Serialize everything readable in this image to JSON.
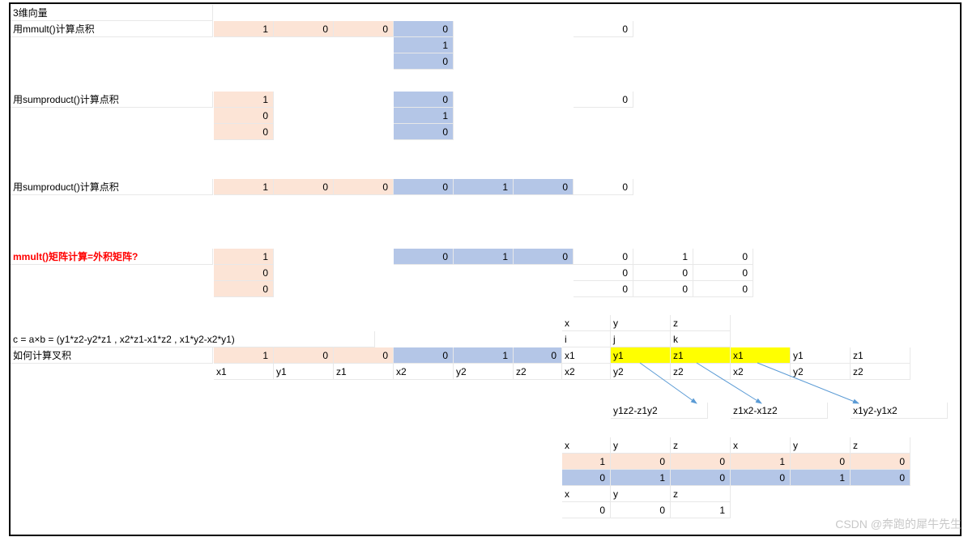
{
  "watermark": "CSDN @奔跑的犀牛先生",
  "labels": {
    "title": "3维向量",
    "mmult": "用mmult()计算点积",
    "sumprod1": "用sumproduct()计算点积",
    "sumprod2": "用sumproduct()计算点积",
    "outer": "mmult()矩阵计算=外积矩阵?",
    "formula": "c = a×b = (y1*z2-y2*z1 , x2*z1-x1*z2 , x1*y2-x2*y1)",
    "cross": "如何计算叉积",
    "x": "x",
    "y": "y",
    "z": "z",
    "i": "i",
    "j": "j",
    "k": "k",
    "x1": "x1",
    "y1": "y1",
    "z1": "z1",
    "x2": "x2",
    "y2": "y2",
    "z2": "z2",
    "d1": "y1z2-z1y2",
    "d2": "z1x2-x1z2",
    "d3": "x1y2-y1x2"
  },
  "v": {
    "v1": [
      1,
      0,
      0
    ],
    "v2": [
      0,
      1,
      0
    ],
    "zero": 0,
    "one": 1,
    "outer": [
      [
        0,
        1,
        0
      ],
      [
        0,
        0,
        0
      ],
      [
        0,
        0,
        0
      ]
    ],
    "bottomA": [
      1,
      0,
      0,
      1,
      0,
      0
    ],
    "bottomB": [
      0,
      1,
      0,
      0,
      1,
      0
    ],
    "final": [
      0,
      0,
      1
    ]
  }
}
